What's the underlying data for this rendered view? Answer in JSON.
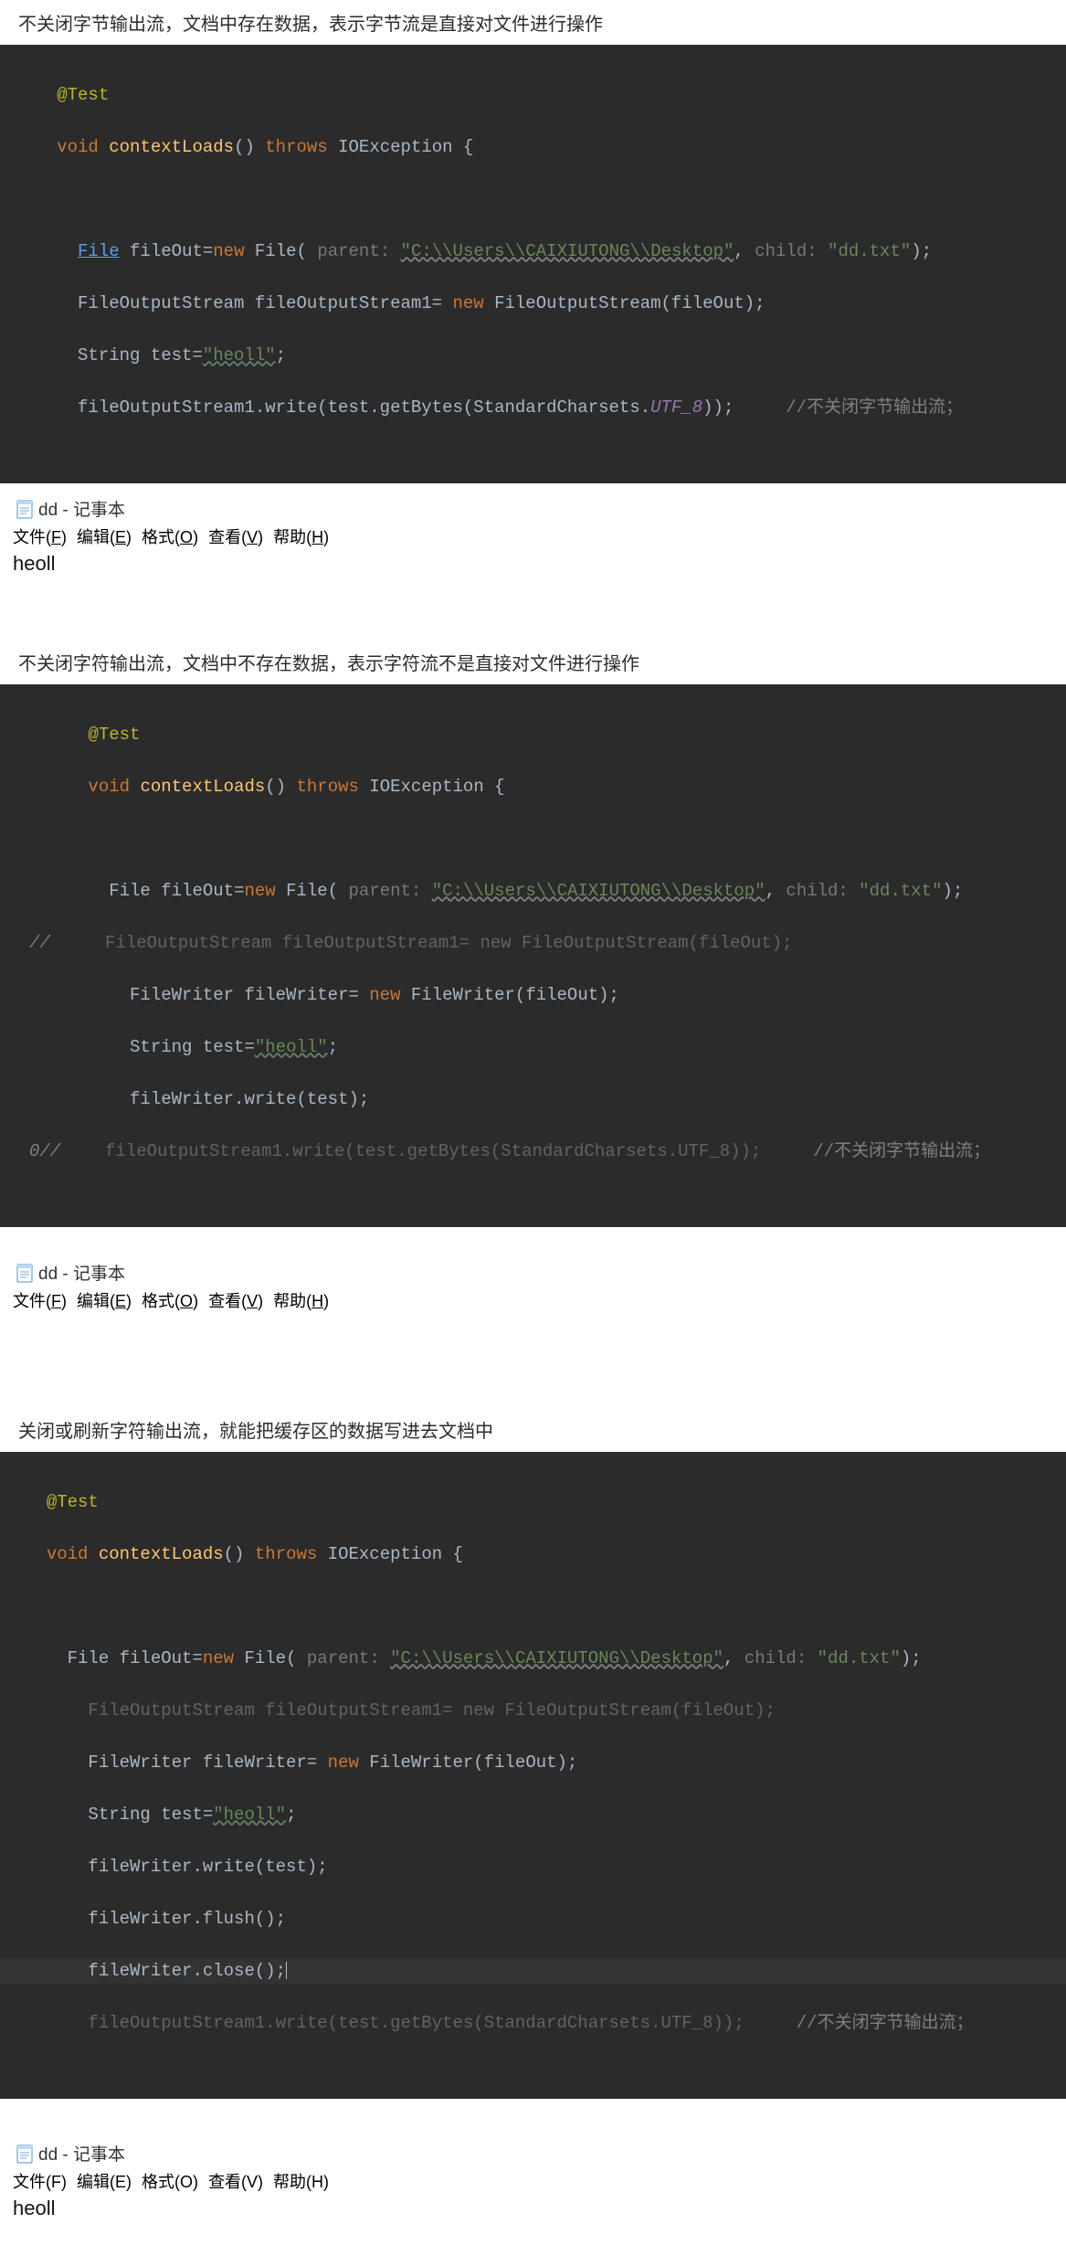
{
  "sections": [
    {
      "caption": "不关闭字节输出流，文档中存在数据，表示字节流是直接对文件进行操作",
      "code": {
        "annot": "@Test",
        "sigPrefix": "void",
        "method": "contextLoads",
        "throwsKw": "throws",
        "exception": "IOException",
        "fileClass": "File",
        "fileVar": "fileOut",
        "newKw": "new",
        "parentHint": "parent:",
        "parentStr": "\"C:\\\\Users\\\\CAIXIUTONG\\\\Desktop\"",
        "childHint": "child:",
        "childStr": "\"dd.txt\"",
        "fosLine": "FileOutputStream fileOutputStream1= ",
        "fosNew": "new",
        "fosCtor": " FileOutputStream(fileOut);",
        "strLine": "String test=",
        "strVal": "\"heoll\"",
        "writeLine": "fileOutputStream1.write(test.getBytes(StandardCharsets.",
        "utf8": "UTF_8",
        "writeTail": "));",
        "comment": "//不关闭字节输出流；"
      },
      "notepad": {
        "title": "dd - 记事本",
        "menu": [
          "文件(F)",
          "编辑(E)",
          "格式(O)",
          "查看(V)",
          "帮助(H)"
        ],
        "body": "heoll"
      }
    },
    {
      "caption": "不关闭字符输出流，文档中不存在数据，表示字符流不是直接对文件进行操作",
      "code": {
        "annot": "@Test",
        "sigPrefix": "void",
        "method": "contextLoads",
        "throwsKw": "throws",
        "exception": "IOException",
        "fileClass": "File",
        "fileVar": "fileOut",
        "newKw": "new",
        "parentHint": "parent:",
        "parentStr": "\"C:\\\\Users\\\\CAIXIUTONG\\\\Desktop\"",
        "childHint": "child:",
        "childStr": "\"dd.txt\"",
        "commentedFos": "FileOutputStream fileOutputStream1= new FileOutputStream(fileOut);",
        "fwLine": "FileWriter fileWriter= ",
        "fwNew": "new",
        "fwCtor": " FileWriter(fileOut);",
        "strLine": "String test=",
        "strVal": "\"heoll\"",
        "fwWrite": "fileWriter.write(test);",
        "commentedWrite": "fileOutputStream1.write(test.getBytes(StandardCharsets.UTF_8));",
        "comment": "//不关闭字节输出流；",
        "gutter1": "//",
        "gutter2": "0//"
      },
      "notepad": {
        "title": "dd - 记事本",
        "menu": [
          "文件(F)",
          "编辑(E)",
          "格式(O)",
          "查看(V)",
          "帮助(H)"
        ],
        "body": ""
      }
    },
    {
      "caption": "关闭或刷新字符输出流，就能把缓存区的数据写进去文档中",
      "code": {
        "annot": "@Test",
        "sigPrefix": "void",
        "method": "contextLoads",
        "throwsKw": "throws",
        "exception": "IOException",
        "fileClass": "File",
        "fileVar": "fileOut",
        "newKw": "new",
        "parentHint": "parent:",
        "parentStr": "\"C:\\\\Users\\\\CAIXIUTONG\\\\Desktop\"",
        "childHint": "child:",
        "childStr": "\"dd.txt\"",
        "commentedFos": "FileOutputStream fileOutputStream1= new FileOutputStream(fileOut);",
        "fwLine": "FileWriter fileWriter= ",
        "fwNew": "new",
        "fwCtor": " FileWriter(fileOut);",
        "strLine": "String test=",
        "strVal": "\"heoll\"",
        "fwWrite": "fileWriter.write(test);",
        "fwFlush": "fileWriter.flush();",
        "fwClose": "fileWriter.close();",
        "commentedWrite": "fileOutputStream1.write(test.getBytes(StandardCharsets.UTF_8));",
        "comment": "//不关闭字节输出流；"
      },
      "notepad": {
        "title": "dd - 记事本",
        "menu": [
          "文件(F)",
          "编辑(E)",
          "格式(O)",
          "查看(V)",
          "帮助(H)"
        ],
        "body": "heoll"
      }
    }
  ]
}
